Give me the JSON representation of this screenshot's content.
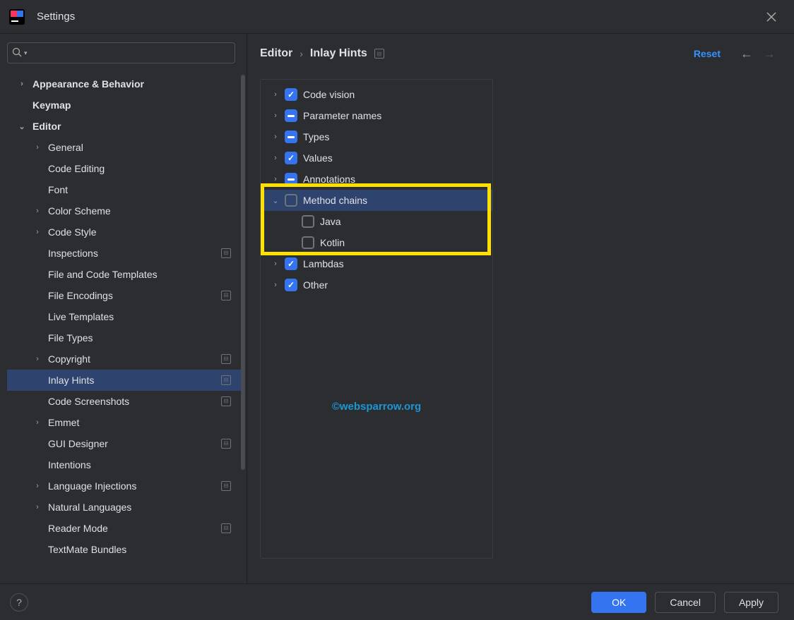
{
  "title": "Settings",
  "search": {
    "placeholder": ""
  },
  "sidebar": {
    "items": [
      {
        "label": "Appearance & Behavior",
        "indent": 0,
        "category": true,
        "expander": "right",
        "badge": false
      },
      {
        "label": "Keymap",
        "indent": 0,
        "category": true,
        "expander": "",
        "badge": false
      },
      {
        "label": "Editor",
        "indent": 0,
        "category": true,
        "expander": "down",
        "badge": false
      },
      {
        "label": "General",
        "indent": 1,
        "expander": "right",
        "badge": false
      },
      {
        "label": "Code Editing",
        "indent": 1,
        "expander": "",
        "badge": false
      },
      {
        "label": "Font",
        "indent": 1,
        "expander": "",
        "badge": false
      },
      {
        "label": "Color Scheme",
        "indent": 1,
        "expander": "right",
        "badge": false
      },
      {
        "label": "Code Style",
        "indent": 1,
        "expander": "right",
        "badge": false
      },
      {
        "label": "Inspections",
        "indent": 1,
        "expander": "",
        "badge": true
      },
      {
        "label": "File and Code Templates",
        "indent": 1,
        "expander": "",
        "badge": false
      },
      {
        "label": "File Encodings",
        "indent": 1,
        "expander": "",
        "badge": true
      },
      {
        "label": "Live Templates",
        "indent": 1,
        "expander": "",
        "badge": false
      },
      {
        "label": "File Types",
        "indent": 1,
        "expander": "",
        "badge": false
      },
      {
        "label": "Copyright",
        "indent": 1,
        "expander": "right",
        "badge": true
      },
      {
        "label": "Inlay Hints",
        "indent": 1,
        "expander": "",
        "badge": true,
        "selected": true
      },
      {
        "label": "Code Screenshots",
        "indent": 1,
        "expander": "",
        "badge": true
      },
      {
        "label": "Emmet",
        "indent": 1,
        "expander": "right",
        "badge": false
      },
      {
        "label": "GUI Designer",
        "indent": 1,
        "expander": "",
        "badge": true
      },
      {
        "label": "Intentions",
        "indent": 1,
        "expander": "",
        "badge": false
      },
      {
        "label": "Language Injections",
        "indent": 1,
        "expander": "right",
        "badge": true
      },
      {
        "label": "Natural Languages",
        "indent": 1,
        "expander": "right",
        "badge": false
      },
      {
        "label": "Reader Mode",
        "indent": 1,
        "expander": "",
        "badge": true
      },
      {
        "label": "TextMate Bundles",
        "indent": 1,
        "expander": "",
        "badge": false
      }
    ]
  },
  "breadcrumb": {
    "root": "Editor",
    "current": "Inlay Hints"
  },
  "reset_label": "Reset",
  "options": [
    {
      "label": "Code vision",
      "state": "checked",
      "expander": "right",
      "selected": false,
      "indent": 0
    },
    {
      "label": "Parameter names",
      "state": "indeterminate",
      "expander": "right",
      "selected": false,
      "indent": 0
    },
    {
      "label": "Types",
      "state": "indeterminate",
      "expander": "right",
      "selected": false,
      "indent": 0
    },
    {
      "label": "Values",
      "state": "checked",
      "expander": "right",
      "selected": false,
      "indent": 0
    },
    {
      "label": "Annotations",
      "state": "indeterminate",
      "expander": "right",
      "selected": false,
      "indent": 0
    },
    {
      "label": "Method chains",
      "state": "unchecked",
      "expander": "down",
      "selected": true,
      "indent": 0
    },
    {
      "label": "Java",
      "state": "unchecked",
      "expander": "",
      "selected": false,
      "indent": 1
    },
    {
      "label": "Kotlin",
      "state": "unchecked",
      "expander": "",
      "selected": false,
      "indent": 1
    },
    {
      "label": "Lambdas",
      "state": "checked",
      "expander": "right",
      "selected": false,
      "indent": 0
    },
    {
      "label": "Other",
      "state": "checked",
      "expander": "right",
      "selected": false,
      "indent": 0
    }
  ],
  "watermark": "©websparrow.org",
  "footer": {
    "ok": "OK",
    "cancel": "Cancel",
    "apply": "Apply"
  }
}
